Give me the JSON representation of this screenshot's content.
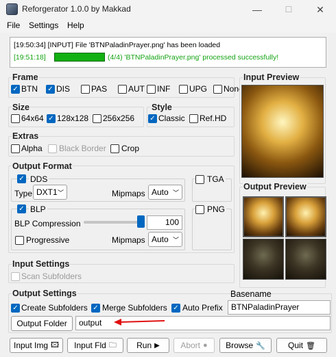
{
  "window": {
    "title": "Reforgerator 1.0.0 by Makkad",
    "controls": [
      "—",
      "☐",
      "✕"
    ]
  },
  "menu": [
    "File",
    "Settings",
    "Help"
  ],
  "log": {
    "line1": "[19:50:34] [INPUT] File 'BTNPaladinPrayer.png' has been loaded",
    "line2_time": "[19:51:18]",
    "line2_msg": "(4/4) 'BTNPaladinPrayer.png' processed successfully!",
    "progress": 1.0,
    "success_color": "#12b012"
  },
  "frame": {
    "title": "Frame",
    "options": [
      {
        "label": "BTN",
        "checked": true
      },
      {
        "label": "DIS",
        "checked": true
      },
      {
        "label": "PAS",
        "checked": false
      },
      {
        "label": "AUT",
        "checked": false
      },
      {
        "label": "INF",
        "checked": false
      },
      {
        "label": "UPG",
        "checked": false
      },
      {
        "label": "None",
        "checked": false
      }
    ]
  },
  "size": {
    "title": "Size",
    "options": [
      {
        "label": "64x64",
        "checked": false
      },
      {
        "label": "128x128",
        "checked": true
      },
      {
        "label": "256x256",
        "checked": false
      }
    ]
  },
  "style": {
    "title": "Style",
    "options": [
      {
        "label": "Classic",
        "checked": true
      },
      {
        "label": "Ref.HD",
        "checked": false
      }
    ]
  },
  "extras": {
    "title": "Extras",
    "alpha": "Alpha",
    "black_border": "Black Border",
    "crop": "Crop"
  },
  "output_format": {
    "title": "Output Format",
    "dds": {
      "label": "DDS",
      "checked": true,
      "type_label": "Type",
      "type_value": "DXT1",
      "mipmaps_label": "Mipmaps",
      "mipmaps_value": "Auto"
    },
    "tga": {
      "label": "TGA",
      "checked": false
    },
    "blp": {
      "label": "BLP",
      "checked": true,
      "compression_label": "BLP Compression",
      "compression_value": "100",
      "slider_level": 100,
      "progressive_label": "Progressive",
      "progressive_checked": false,
      "mipmaps_label": "Mipmaps",
      "mipmaps_value": "Auto"
    },
    "png": {
      "label": "PNG",
      "checked": false
    }
  },
  "input_settings": {
    "title": "Input Settings",
    "scan_subfolders": "Scan Subfolders"
  },
  "output_settings": {
    "title": "Output Settings",
    "create_subfolders": "Create Subfolders",
    "merge_subfolders": "Merge Subfolders",
    "auto_prefix": "Auto Prefix",
    "basename_label": "Basename",
    "basename_value": "BTNPaladinPrayer",
    "output_folder_button": "Output Folder",
    "output_folder_value": "output",
    "arrow_color": "#e01010"
  },
  "previews": {
    "input_title": "Input Preview",
    "output_title": "Output Preview"
  },
  "buttons": {
    "input_img": "Input Img",
    "input_fld": "Input Fld",
    "run": "Run",
    "abort": "Abort",
    "browse": "Browse",
    "quit": "Quit"
  },
  "icons": [
    "app-icon",
    "check-icon",
    "dropdown-chevron-icon",
    "image-icon",
    "folder-icon",
    "play-icon",
    "stop-icon",
    "wrench-icon",
    "trash-icon",
    "red-arrow-icon"
  ]
}
